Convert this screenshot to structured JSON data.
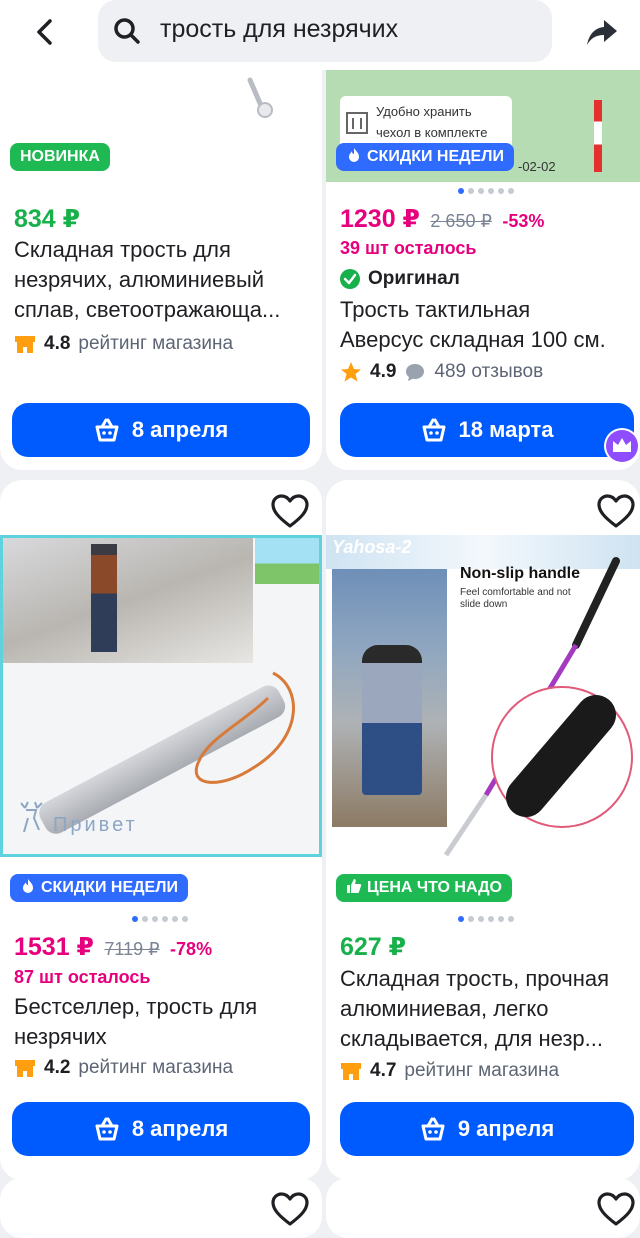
{
  "search": {
    "query": "трость для незрячих"
  },
  "icons": {
    "back": "chevron-left-icon",
    "search": "search-icon",
    "share": "share-icon",
    "favorite": "heart-icon",
    "cart": "basket-icon",
    "shop": "shop-icon",
    "star": "star-icon",
    "reviews": "comment-icon",
    "fire": "fire-icon",
    "thumb": "thumbs-up-icon",
    "check": "check-icon",
    "premium": "crown-icon"
  },
  "colors": {
    "blue": "#005bff",
    "green": "#17b04a",
    "pink": "#e6007e"
  },
  "cards": [
    {
      "badge": "НОВИНКА",
      "price": "834 ₽",
      "title_lines": [
        "Складная трость для",
        "незрячих, алюминиевый",
        "сплав, светоотражающа..."
      ],
      "rating": "4.8",
      "rating_label": "рейтинг магазина",
      "button": "8 апреля"
    },
    {
      "image_text_1": "Удобно хранить",
      "image_text_2": "чехол в комплекте",
      "image_date": "-02-02",
      "badge": "СКИДКИ НЕДЕЛИ",
      "price": "1230 ₽",
      "old_price": "2 650 ₽",
      "discount": "-53%",
      "stock": "39 шт осталось",
      "original": "Оригинал",
      "title_lines": [
        "Трость тактильная",
        "Аверсус складная 100 см."
      ],
      "rating": "4.9",
      "reviews": "489 отзывов",
      "button": "18 марта"
    },
    {
      "watermark": "Привет",
      "badge": "СКИДКИ НЕДЕЛИ",
      "price": "1531 ₽",
      "old_price": "7119 ₽",
      "discount": "-78%",
      "stock": "87 шт осталось",
      "title_lines": [
        "Бестселлер, трость для",
        "незрячих"
      ],
      "rating": "4.2",
      "rating_label": "рейтинг магазина",
      "button": "8 апреля"
    },
    {
      "image_brand": "Yahosa-2",
      "image_heading": "Non-slip handle",
      "image_sub_1": "Feel comfortable and not",
      "image_sub_2": "slide down",
      "badge": "ЦЕНА ЧТО НАДО",
      "price": "627 ₽",
      "title_lines": [
        "Складная трость, прочная",
        "алюминиевая, легко",
        "складывается, для незр..."
      ],
      "rating": "4.7",
      "rating_label": "рейтинг магазина",
      "button": "9 апреля"
    }
  ]
}
